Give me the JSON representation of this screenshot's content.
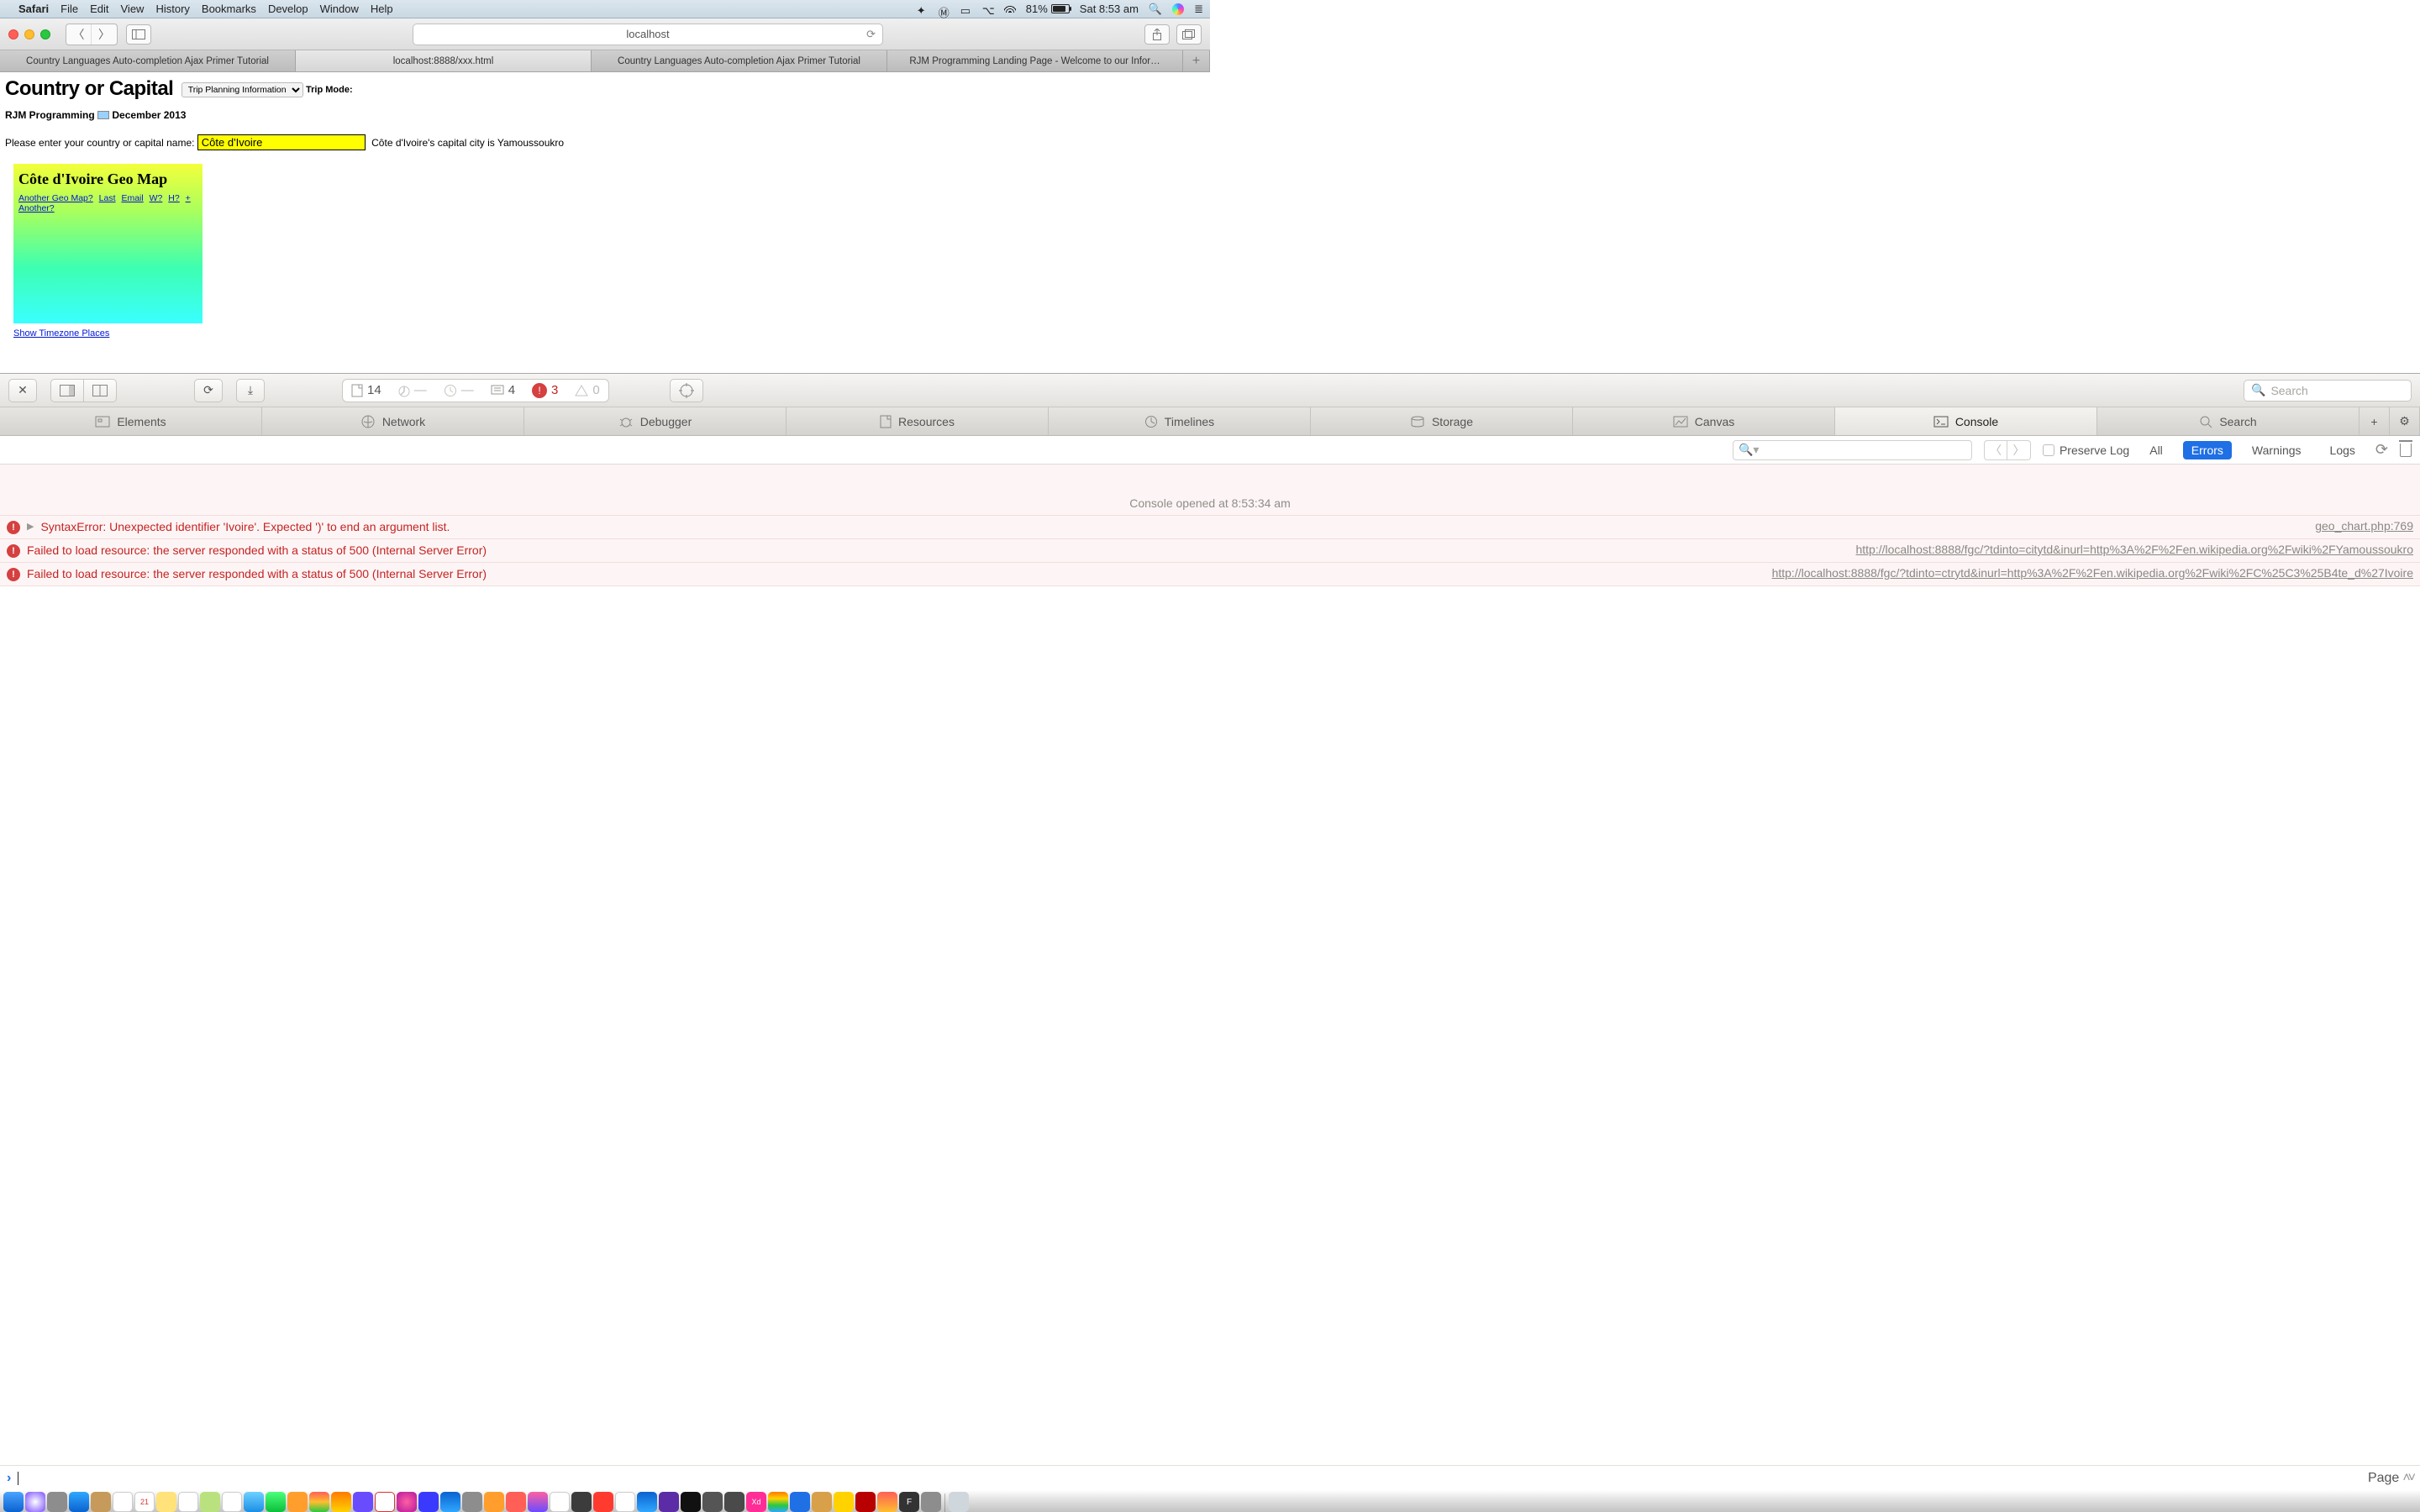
{
  "menubar": {
    "app": "Safari",
    "items": [
      "File",
      "Edit",
      "View",
      "History",
      "Bookmarks",
      "Develop",
      "Window",
      "Help"
    ],
    "battery_pct": "81%",
    "clock": "Sat 8:53 am"
  },
  "safari": {
    "url_display": "localhost",
    "tabs": [
      "Country Languages Auto-completion Ajax Primer Tutorial",
      "localhost:8888/xxx.html",
      "Country Languages Auto-completion Ajax Primer Tutorial",
      "RJM Programming Landing Page - Welcome to our Infor…"
    ],
    "active_tab_index": 1
  },
  "page": {
    "heading": "Country or Capital",
    "select_value": "Trip Planning Information",
    "trip_mode_label": "Trip Mode:",
    "byline_left": "RJM Programming",
    "byline_right": "December 2013",
    "prompt_label": "Please enter your country or capital name: ",
    "input_value": "Côte d'Ivoire",
    "hint_text": "Côte d'Ivoire's capital city is Yamoussoukro",
    "geo_title": "Côte d'Ivoire Geo Map",
    "geo_links": [
      "Another Geo Map?",
      "Last",
      "Email",
      "W?",
      "H?",
      "+",
      "Another?"
    ],
    "show_tz": "Show Timezone Places"
  },
  "inspector": {
    "resource_count": "14",
    "log_count": "4",
    "error_count": "3",
    "warning_count": "0",
    "search_placeholder": "Search",
    "tabs": [
      "Elements",
      "Network",
      "Debugger",
      "Resources",
      "Timelines",
      "Storage",
      "Canvas",
      "Console",
      "Search"
    ],
    "active_tab": "Console",
    "console_search_placeholder": "",
    "preserve_log_label": "Preserve Log",
    "filters": [
      "All",
      "Errors",
      "Warnings",
      "Logs"
    ],
    "active_filter": "Errors",
    "opened_text": "Console opened at 8:53:34 am",
    "rows": [
      {
        "msg": "SyntaxError: Unexpected identifier 'Ivoire'. Expected ')' to end an argument list.",
        "loc": "geo_chart.php:769",
        "expandable": true
      },
      {
        "msg": "Failed to load resource: the server responded with a status of 500 (Internal Server Error)",
        "url": "http://localhost:8888/fgc/?tdinto=citytd&inurl=http%3A%2F%2Fen.wikipedia.org%2Fwiki%2FYamoussoukro",
        "expandable": false
      },
      {
        "msg": "Failed to load resource: the server responded with a status of 500 (Internal Server Error)",
        "url": "http://localhost:8888/fgc/?tdinto=ctrytd&inurl=http%3A%2F%2Fen.wikipedia.org%2Fwiki%2FC%25C3%25B4te_d%27Ivoire",
        "expandable": false
      }
    ],
    "scope": "Page"
  }
}
